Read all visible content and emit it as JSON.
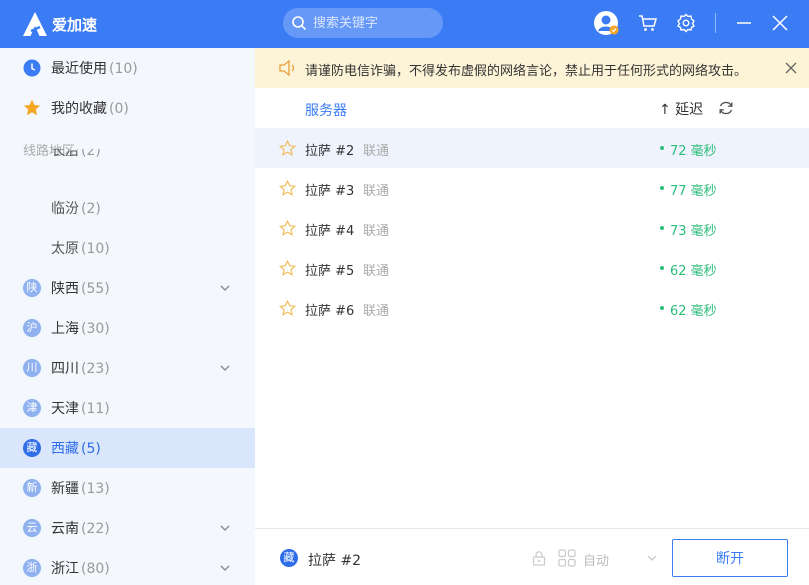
{
  "app": {
    "title": "爱加速",
    "logo_icon": "app-logo-icon"
  },
  "search": {
    "placeholder": "搜索关键字",
    "value": ""
  },
  "titlebar": {
    "icons": [
      "avatar-icon",
      "cart-icon",
      "gear-icon",
      "minimize-icon",
      "close-icon"
    ]
  },
  "sidebar": {
    "recent": {
      "label": "最近使用",
      "count": "(10)",
      "icon": "clock-icon"
    },
    "favorites": {
      "label": "我的收藏",
      "count": "(0)",
      "icon": "star-icon"
    },
    "section_title": "线路地区",
    "sub_items": [
      {
        "label": "长治",
        "count": "(2)"
      },
      {
        "label": "临汾",
        "count": "(2)"
      },
      {
        "label": "太原",
        "count": "(10)"
      }
    ],
    "provinces": [
      {
        "badge": "陕",
        "label": "陕西",
        "count": "(55)",
        "expandable": true
      },
      {
        "badge": "沪",
        "label": "上海",
        "count": "(30)",
        "expandable": false
      },
      {
        "badge": "川",
        "label": "四川",
        "count": "(23)",
        "expandable": true
      },
      {
        "badge": "津",
        "label": "天津",
        "count": "(11)",
        "expandable": false
      },
      {
        "badge": "藏",
        "label": "西藏",
        "count": "(5)",
        "expandable": false,
        "active": true
      },
      {
        "badge": "新",
        "label": "新疆",
        "count": "(13)",
        "expandable": false
      },
      {
        "badge": "云",
        "label": "云南",
        "count": "(22)",
        "expandable": true
      },
      {
        "badge": "浙",
        "label": "浙江",
        "count": "(80)",
        "expandable": true
      }
    ]
  },
  "notice": {
    "text": "请谨防电信诈骗，不得发布虚假的网络言论，禁止用于任何形式的网络攻击。"
  },
  "list": {
    "col_server": "服务器",
    "col_latency": "↑ 延迟",
    "rows": [
      {
        "name": "拉萨 #2",
        "isp": "联通",
        "ping": "72 毫秒",
        "selected": true
      },
      {
        "name": "拉萨 #3",
        "isp": "联通",
        "ping": "77 毫秒"
      },
      {
        "name": "拉萨 #4",
        "isp": "联通",
        "ping": "73 毫秒"
      },
      {
        "name": "拉萨 #5",
        "isp": "联通",
        "ping": "62 毫秒"
      },
      {
        "name": "拉萨 #6",
        "isp": "联通",
        "ping": "62 毫秒"
      }
    ]
  },
  "footer": {
    "badge": "藏",
    "current": "拉萨 #2",
    "mode": "自动",
    "disconnect": "断开"
  },
  "colors": {
    "primary": "#3b7cf5",
    "accent_green": "#2dbd7a",
    "notice_bg": "#fdf4d8",
    "sidebar_bg": "#f4f7fc",
    "active_bg": "#d9e6fb"
  }
}
